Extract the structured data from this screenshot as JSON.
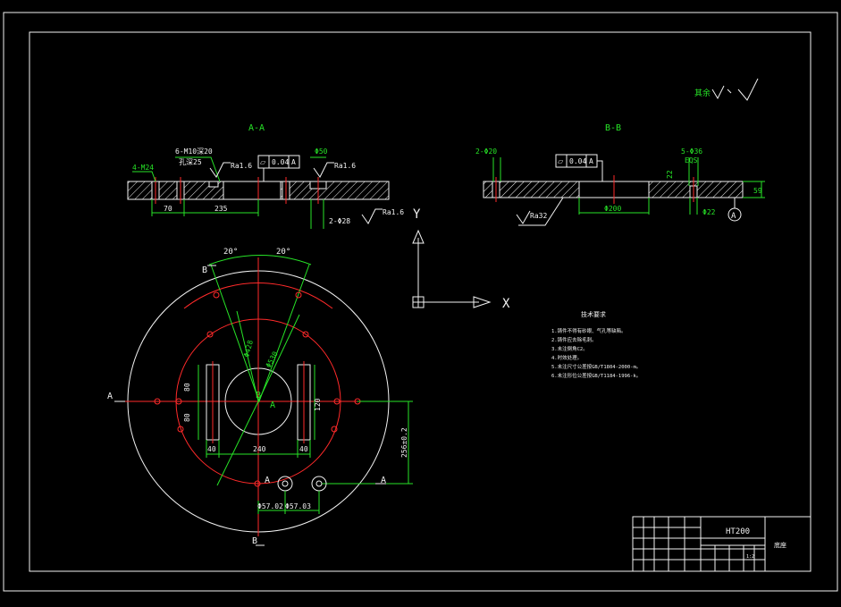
{
  "section_labels": {
    "aa": "A-A",
    "bb": "B-B"
  },
  "roughness_note": {
    "prefix": "其余"
  },
  "section_aa": {
    "holes_label": "6-M10深20",
    "hole_depth": "孔深25",
    "ra_left": "Ra1.6",
    "flatness_sym": "⏥",
    "flatness_val": "0.04",
    "flatness_datum": "A",
    "dia_top": "Φ50",
    "ra_right": "Ra1.6",
    "pins_label": "4-M24",
    "dim_70": "70",
    "dim_235": "235",
    "holes_bottom": "2-Φ28",
    "ra_bottom": "Ra1.6"
  },
  "section_bb": {
    "holes_left": "2-Φ20",
    "flatness_sym": "⏥",
    "flatness_val": "0.04",
    "flatness_datum": "A",
    "holes_right": "5-Φ36",
    "eqs": "EQS",
    "dim_22": "22",
    "dim_59": "59",
    "ra_left": "Ra32",
    "dia_200": "Φ200",
    "dia_22": "Φ22",
    "datum": "A"
  },
  "axes": {
    "y": "Y",
    "x": "X"
  },
  "plan_view": {
    "angle_left": "20°",
    "angle_right": "20°",
    "dia_inner": "Φ530",
    "dia_outer": "Φ428",
    "dim_80a": "80",
    "dim_80b": "80",
    "dim_120": "120",
    "dim_40a": "40",
    "dim_240": "240",
    "dim_40b": "40",
    "dim_256": "256±0.2",
    "dim_bottom_a": "Φ57.02",
    "dim_bottom_b": "Φ57.03",
    "label_B_top": "B",
    "label_B_center": "B",
    "label_A_center": "A",
    "label_A_left": "A",
    "label_A_bottom": "A",
    "label_A_right": "A",
    "label_B_bottom": "B"
  },
  "tech_notes": {
    "title": "技术要求",
    "lines": [
      "1.铸件不得有砂眼、气孔等缺陷。",
      "2.铸件应去除毛刺。",
      "3.未注倒角C2。",
      "4.时效处理。",
      "5.未注尺寸公差按GB/T1804-2000-m。",
      "6.未注形位公差按GB/T1184-1996-k。"
    ]
  },
  "title_block": {
    "material": "HT200",
    "part_name": "底座",
    "scale": "1:2"
  },
  "colors": {
    "green": "#27e427",
    "white": "#f2f2f2",
    "red": "#ff2a2a"
  }
}
